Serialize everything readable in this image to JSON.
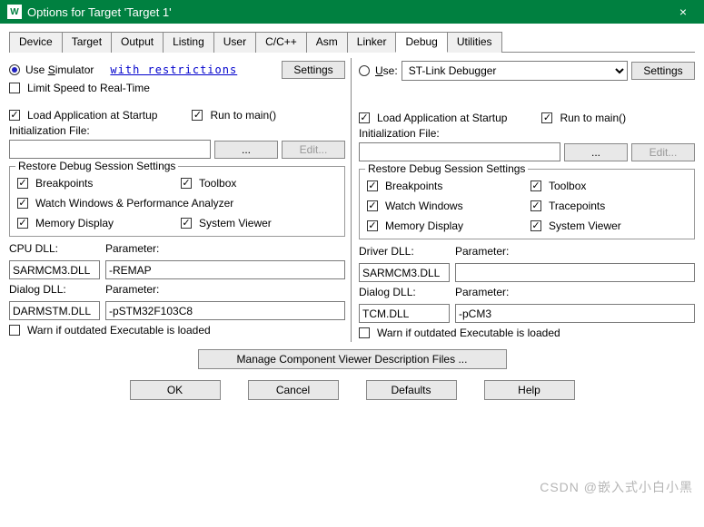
{
  "titlebar": {
    "title": "Options for Target 'Target 1'",
    "close": "×"
  },
  "tabs": [
    "Device",
    "Target",
    "Output",
    "Listing",
    "User",
    "C/C++",
    "Asm",
    "Linker",
    "Debug",
    "Utilities"
  ],
  "left": {
    "use_sim": "Use Simulator",
    "restrictions": "with restrictions",
    "settings": "Settings",
    "limit_speed": "Limit Speed to Real-Time",
    "load_app": "Load Application at Startup",
    "run_main": "Run to main()",
    "init_file": "Initialization File:",
    "init_val": "",
    "browse": "...",
    "edit": "Edit...",
    "restore_legend": "Restore Debug Session Settings",
    "bp": "Breakpoints",
    "toolbox": "Toolbox",
    "watch": "Watch Windows & Performance Analyzer",
    "mem": "Memory Display",
    "sysview": "System Viewer",
    "cpu_dll_lbl": "CPU DLL:",
    "param_lbl": "Parameter:",
    "cpu_dll": "SARMCM3.DLL",
    "cpu_param": "-REMAP",
    "dlg_dll_lbl": "Dialog DLL:",
    "dlg_dll": "DARMSTM.DLL",
    "dlg_param": "-pSTM32F103C8",
    "warn": "Warn if outdated Executable is loaded"
  },
  "right": {
    "use": "Use:",
    "debugger": "ST-Link Debugger",
    "settings": "Settings",
    "load_app": "Load Application at Startup",
    "run_main": "Run to main()",
    "init_file": "Initialization File:",
    "init_val": "",
    "browse": "...",
    "edit": "Edit...",
    "restore_legend": "Restore Debug Session Settings",
    "bp": "Breakpoints",
    "toolbox": "Toolbox",
    "watch": "Watch Windows",
    "trace": "Tracepoints",
    "mem": "Memory Display",
    "sysview": "System Viewer",
    "drv_dll_lbl": "Driver DLL:",
    "param_lbl": "Parameter:",
    "drv_dll": "SARMCM3.DLL",
    "drv_param": "",
    "dlg_dll_lbl": "Dialog DLL:",
    "dlg_dll": "TCM.DLL",
    "dlg_param": "-pCM3",
    "warn": "Warn if outdated Executable is loaded"
  },
  "manage_btn": "Manage Component Viewer Description Files ...",
  "buttons": {
    "ok": "OK",
    "cancel": "Cancel",
    "defaults": "Defaults",
    "help": "Help"
  },
  "watermark": "CSDN @嵌入式小白小黑"
}
